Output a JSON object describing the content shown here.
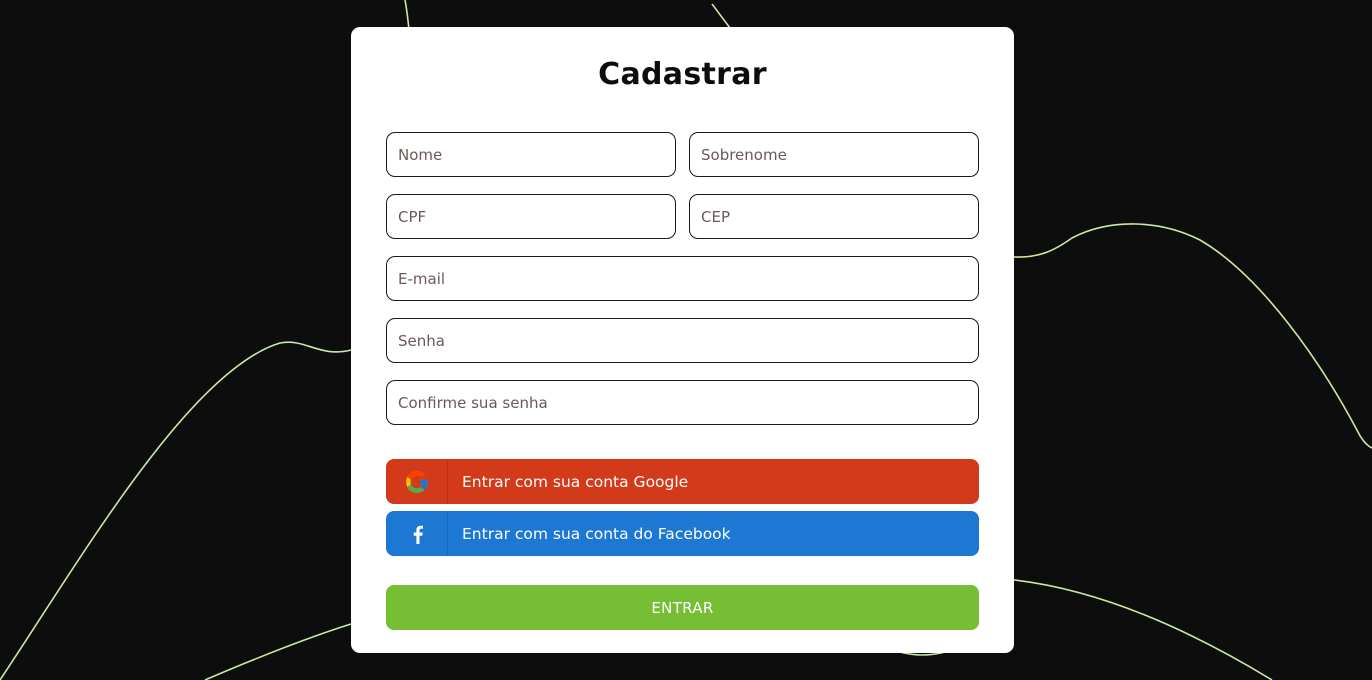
{
  "form": {
    "title": "Cadastrar",
    "fields": {
      "first_name": {
        "placeholder": "Nome",
        "value": ""
      },
      "last_name": {
        "placeholder": "Sobrenome",
        "value": ""
      },
      "cpf": {
        "placeholder": "CPF",
        "value": ""
      },
      "cep": {
        "placeholder": "CEP",
        "value": ""
      },
      "email": {
        "placeholder": "E-mail",
        "value": ""
      },
      "password": {
        "placeholder": "Senha",
        "value": ""
      },
      "confirm_password": {
        "placeholder": "Confirme sua senha",
        "value": ""
      }
    },
    "google_button": {
      "label": "Entrar com sua conta Google",
      "icon": "google-icon",
      "color": "#d33a1a"
    },
    "facebook_button": {
      "label": "Entrar com sua conta do Facebook",
      "icon": "facebook-icon",
      "color": "#1c78d3"
    },
    "submit_button": {
      "label": "ENTRAR",
      "color": "#76bf35"
    }
  },
  "colors": {
    "background": "#0d0d0d",
    "card": "#ffffff",
    "decorative_lines": "#c9e9a6"
  }
}
